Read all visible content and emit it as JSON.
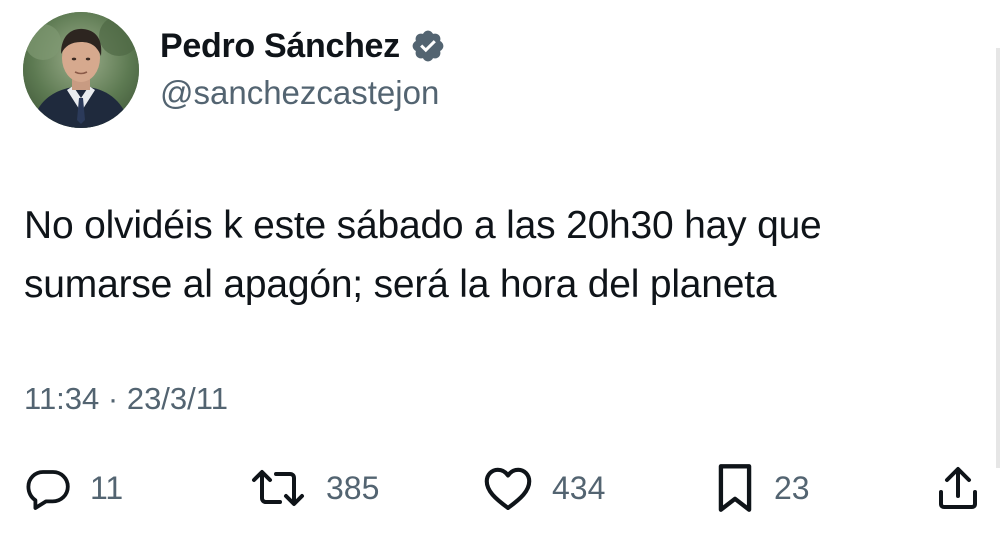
{
  "author": {
    "display_name": "Pedro Sánchez",
    "handle": "@sanchezcastejon",
    "verified": true,
    "verified_color": "#536471"
  },
  "tweet": {
    "text": "No olvidéis k este sábado a las 20h30 hay que sumarse al apagón; será la hora del planeta",
    "timestamp": "11:34 · 23/3/11"
  },
  "actions": {
    "replies": "11",
    "retweets": "385",
    "likes": "434",
    "bookmarks": "23"
  },
  "icons": [
    "verified-icon",
    "reply-icon",
    "retweet-icon",
    "like-icon",
    "bookmark-icon",
    "share-icon"
  ],
  "colors": {
    "text_primary": "#0f1419",
    "text_secondary": "#536471",
    "background": "#ffffff"
  }
}
